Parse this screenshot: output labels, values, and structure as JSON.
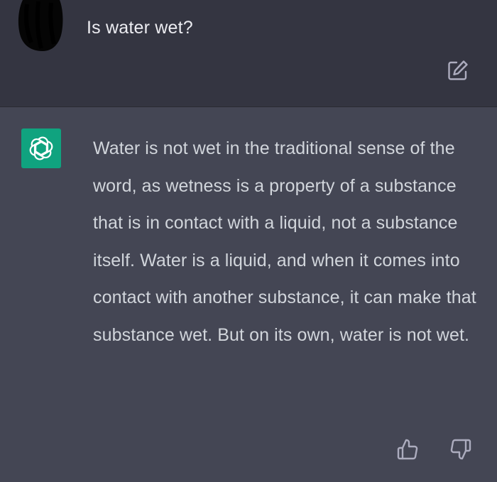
{
  "user_message": {
    "text": "Is water wet?"
  },
  "assistant_message": {
    "text": "Water is not wet in the traditional sense of the word, as wetness is a property of a substance that is in contact with a liquid, not a substance itself. Water is a liquid, and when it comes into contact with another substance, it can make that substance wet. But on its own, water is not wet."
  },
  "icons": {
    "edit": "edit-pencil-icon",
    "assistant_logo": "openai-logo-icon",
    "thumbs_up": "thumbs-up-icon",
    "thumbs_down": "thumbs-down-icon"
  },
  "colors": {
    "user_bg": "#343541",
    "assistant_bg": "#444654",
    "accent": "#10a37f",
    "text_primary": "#ececf1",
    "text_secondary": "#d1d5db",
    "icon": "#acacbe"
  }
}
